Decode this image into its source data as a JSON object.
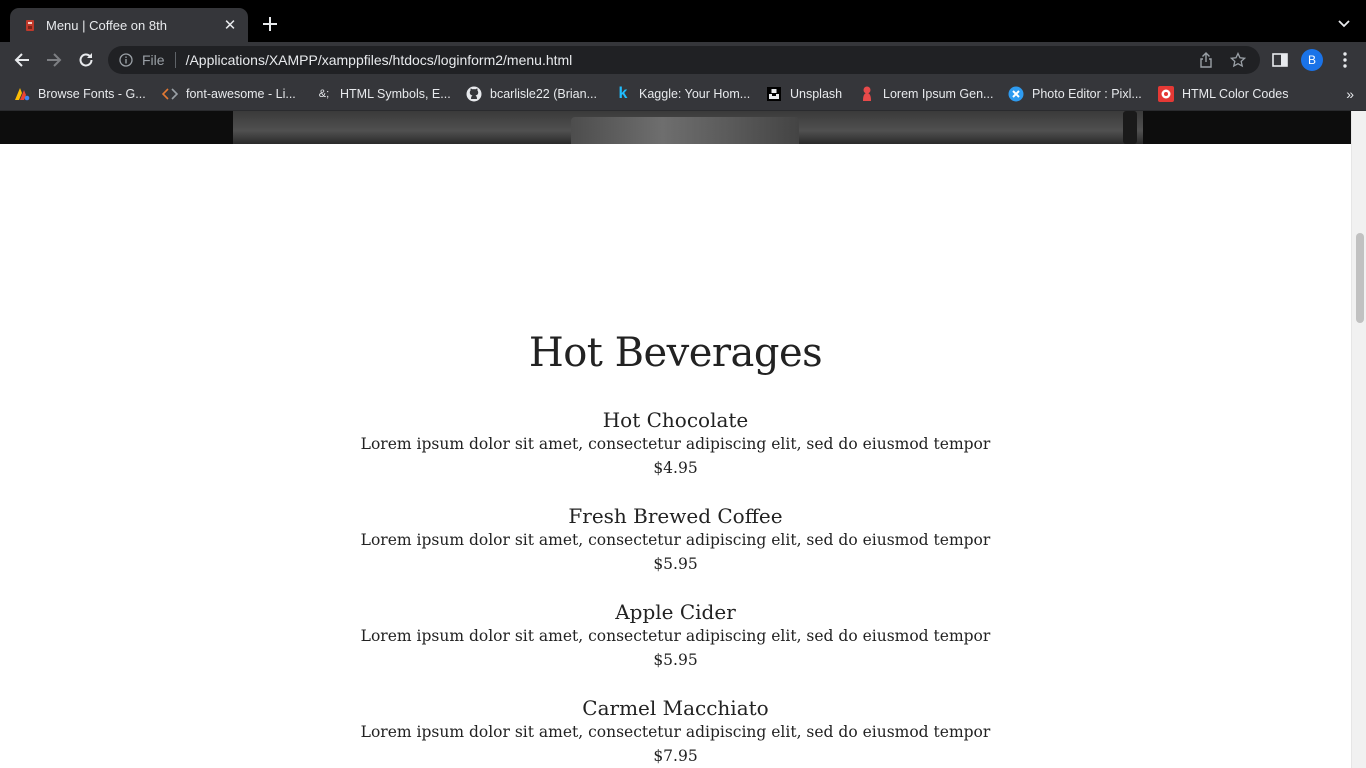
{
  "browser": {
    "tab": {
      "title": "Menu | Coffee on 8th"
    },
    "address": {
      "scheme_label": "File",
      "url": "/Applications/XAMPP/xamppfiles/htdocs/loginform2/menu.html"
    },
    "profile_initial": "B",
    "bookmarks": [
      {
        "label": "Browse Fonts - G...",
        "icon": "google-fonts-icon"
      },
      {
        "label": "font-awesome - Li...",
        "icon": "code-brackets-icon"
      },
      {
        "label": "HTML Symbols, E...",
        "icon_text": "&;",
        "icon": "ampersand-icon"
      },
      {
        "label": "bcarlisle22 (Brian...",
        "icon": "github-icon"
      },
      {
        "label": "Kaggle: Your Hom...",
        "icon_text": "k",
        "icon": "kaggle-icon"
      },
      {
        "label": "Unsplash",
        "icon": "unsplash-icon"
      },
      {
        "label": "Lorem Ipsum Gen...",
        "icon": "lorem-ipsum-icon"
      },
      {
        "label": "Photo Editor : Pixl...",
        "icon": "pixlr-icon"
      },
      {
        "label": "HTML Color Codes",
        "icon": "color-codes-icon"
      }
    ],
    "more_bookmarks": "»"
  },
  "page": {
    "section_title": "Hot Beverages",
    "items": [
      {
        "name": "Hot Chocolate",
        "description": "Lorem ipsum dolor sit amet, consectetur adipiscing elit, sed do eiusmod tempor",
        "price": "$4.95"
      },
      {
        "name": "Fresh Brewed Coffee",
        "description": "Lorem ipsum dolor sit amet, consectetur adipiscing elit, sed do eiusmod tempor",
        "price": "$5.95"
      },
      {
        "name": "Apple Cider",
        "description": "Lorem ipsum dolor sit amet, consectetur adipiscing elit, sed do eiusmod tempor",
        "price": "$5.95"
      },
      {
        "name": "Carmel Macchiato",
        "description": "Lorem ipsum dolor sit amet, consectetur adipiscing elit, sed do eiusmod tempor",
        "price": "$7.95"
      }
    ]
  },
  "colors": {
    "chrome_dark": "#35363a",
    "tabstrip": "#000000",
    "omnibox": "#202124",
    "avatar": "#1a73e8",
    "page_text": "#222222"
  }
}
